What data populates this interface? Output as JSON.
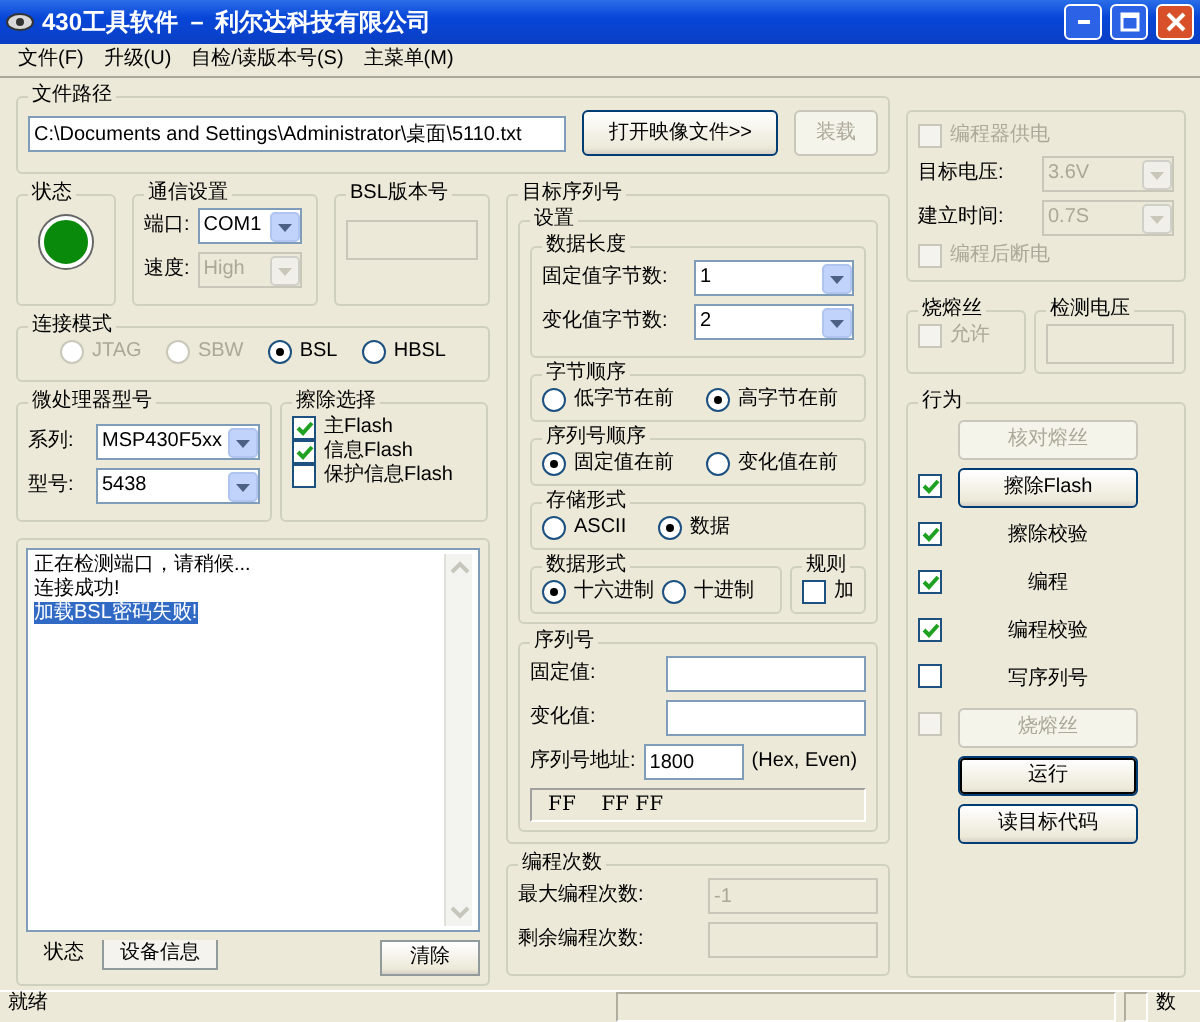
{
  "window": {
    "title": "430工具软件 － 利尔达科技有限公司"
  },
  "menu": [
    "文件(F)",
    "升级(U)",
    "自检/读版本号(S)",
    "主菜单(M)"
  ],
  "file_path": {
    "label": "文件路径",
    "value": "C:\\Documents and Settings\\Administrator\\桌面\\5110.txt",
    "buttons": [
      {
        "label": "打开映像文件>>",
        "disabled": false
      },
      {
        "label": "装载",
        "disabled": true
      }
    ]
  },
  "status": {
    "label": "状态",
    "on": true
  },
  "comm": {
    "label": "通信设置",
    "fields": [
      {
        "label": "端口:",
        "value": "COM1",
        "disabled": false
      },
      {
        "label": "速度:",
        "value": "High",
        "disabled": true
      }
    ]
  },
  "bsl_version": {
    "label": "BSL版本号"
  },
  "connect_mode": {
    "label": "连接模式",
    "options": [
      {
        "label": "JTAG",
        "selected": false,
        "disabled": true
      },
      {
        "label": "SBW",
        "selected": false,
        "disabled": true
      },
      {
        "label": "BSL",
        "selected": true,
        "disabled": false
      },
      {
        "label": "HBSL",
        "selected": false,
        "disabled": false
      }
    ]
  },
  "mcu": {
    "label": "微处理器型号",
    "fields": [
      {
        "label": "系列:",
        "value": "MSP430F5xx"
      },
      {
        "label": "型号:",
        "value": "5438"
      }
    ]
  },
  "erase": {
    "label": "擦除选择",
    "options": [
      {
        "label": "主Flash",
        "checked": true
      },
      {
        "label": "信息Flash",
        "checked": true
      },
      {
        "label": "保护信息Flash",
        "checked": false
      }
    ]
  },
  "log": {
    "lines": [
      {
        "text": "正在检测端口，请稍候...",
        "selected": false
      },
      {
        "text": "连接成功!",
        "selected": false
      },
      {
        "text": "加载BSL密码失败!",
        "selected": true
      }
    ]
  },
  "log_tabs": [
    {
      "label": "状态",
      "selected": true
    },
    {
      "label": "设备信息",
      "selected": false
    }
  ],
  "clear_button": "清除",
  "target_serial": {
    "label": "目标序列号",
    "settings": {
      "label": "设置",
      "data_length": {
        "label": "数据长度",
        "fields": [
          {
            "label": "固定值字节数:",
            "value": "1"
          },
          {
            "label": "变化值字节数:",
            "value": "2"
          }
        ]
      },
      "radio_groups": [
        {
          "label": "字节顺序",
          "options": [
            {
              "label": "低字节在前",
              "selected": false
            },
            {
              "label": "高字节在前",
              "selected": true
            }
          ]
        },
        {
          "label": "序列号顺序",
          "options": [
            {
              "label": "固定值在前",
              "selected": true
            },
            {
              "label": "变化值在前",
              "selected": false
            }
          ]
        },
        {
          "label": "存储形式",
          "options": [
            {
              "label": "ASCII",
              "selected": false
            },
            {
              "label": "数据",
              "selected": true
            }
          ]
        },
        {
          "label": "数据形式",
          "options": [
            {
              "label": "十六进制",
              "selected": true
            },
            {
              "label": "十进制",
              "selected": false
            }
          ]
        }
      ],
      "rule": {
        "label": "规则",
        "option": {
          "label": "加",
          "checked": false
        }
      }
    },
    "serial": {
      "label": "序列号",
      "fields": [
        {
          "label": "固定值:"
        },
        {
          "label": "变化值:"
        }
      ],
      "address": {
        "label": "序列号地址:",
        "value": "1800",
        "hint": "(Hex, Even)"
      },
      "preview": "FF    FF FF"
    }
  },
  "program_count": {
    "label": "编程次数",
    "fields": [
      {
        "label": "最大编程次数:",
        "value": "-1"
      },
      {
        "label": "剩余编程次数:"
      }
    ]
  },
  "power": {
    "disabled": true,
    "supply": {
      "label": "编程器供电",
      "checked": false
    },
    "fields": [
      {
        "label": "目标电压:",
        "value": "3.6V"
      },
      {
        "label": "建立时间:",
        "value": "0.7S"
      }
    ],
    "cutoff": {
      "label": "编程后断电",
      "checked": false
    }
  },
  "fuse": {
    "label": "烧熔丝",
    "allow": {
      "label": "允许",
      "checked": false,
      "disabled": true
    }
  },
  "detect_voltage": {
    "label": "检测电压"
  },
  "actions": {
    "label": "行为",
    "rows": [
      {
        "kind": "button",
        "label": "核对熔丝",
        "disabled": true,
        "default": false
      },
      {
        "kind": "check-button",
        "label": "擦除Flash",
        "checked": true,
        "disabled": false
      },
      {
        "kind": "check-label",
        "label": "擦除校验",
        "checked": true
      },
      {
        "kind": "check-label",
        "label": "编程",
        "checked": true
      },
      {
        "kind": "check-label",
        "label": "编程校验",
        "checked": true
      },
      {
        "kind": "check-label",
        "label": "写序列号",
        "checked": false
      },
      {
        "kind": "check-button",
        "label": "烧熔丝",
        "checked": false,
        "disabled": true
      },
      {
        "kind": "button",
        "label": "运行",
        "disabled": false,
        "default": true
      },
      {
        "kind": "button",
        "label": "读目标代码",
        "disabled": false,
        "default": false
      }
    ]
  },
  "status_bar": [
    "就绪",
    "数"
  ]
}
